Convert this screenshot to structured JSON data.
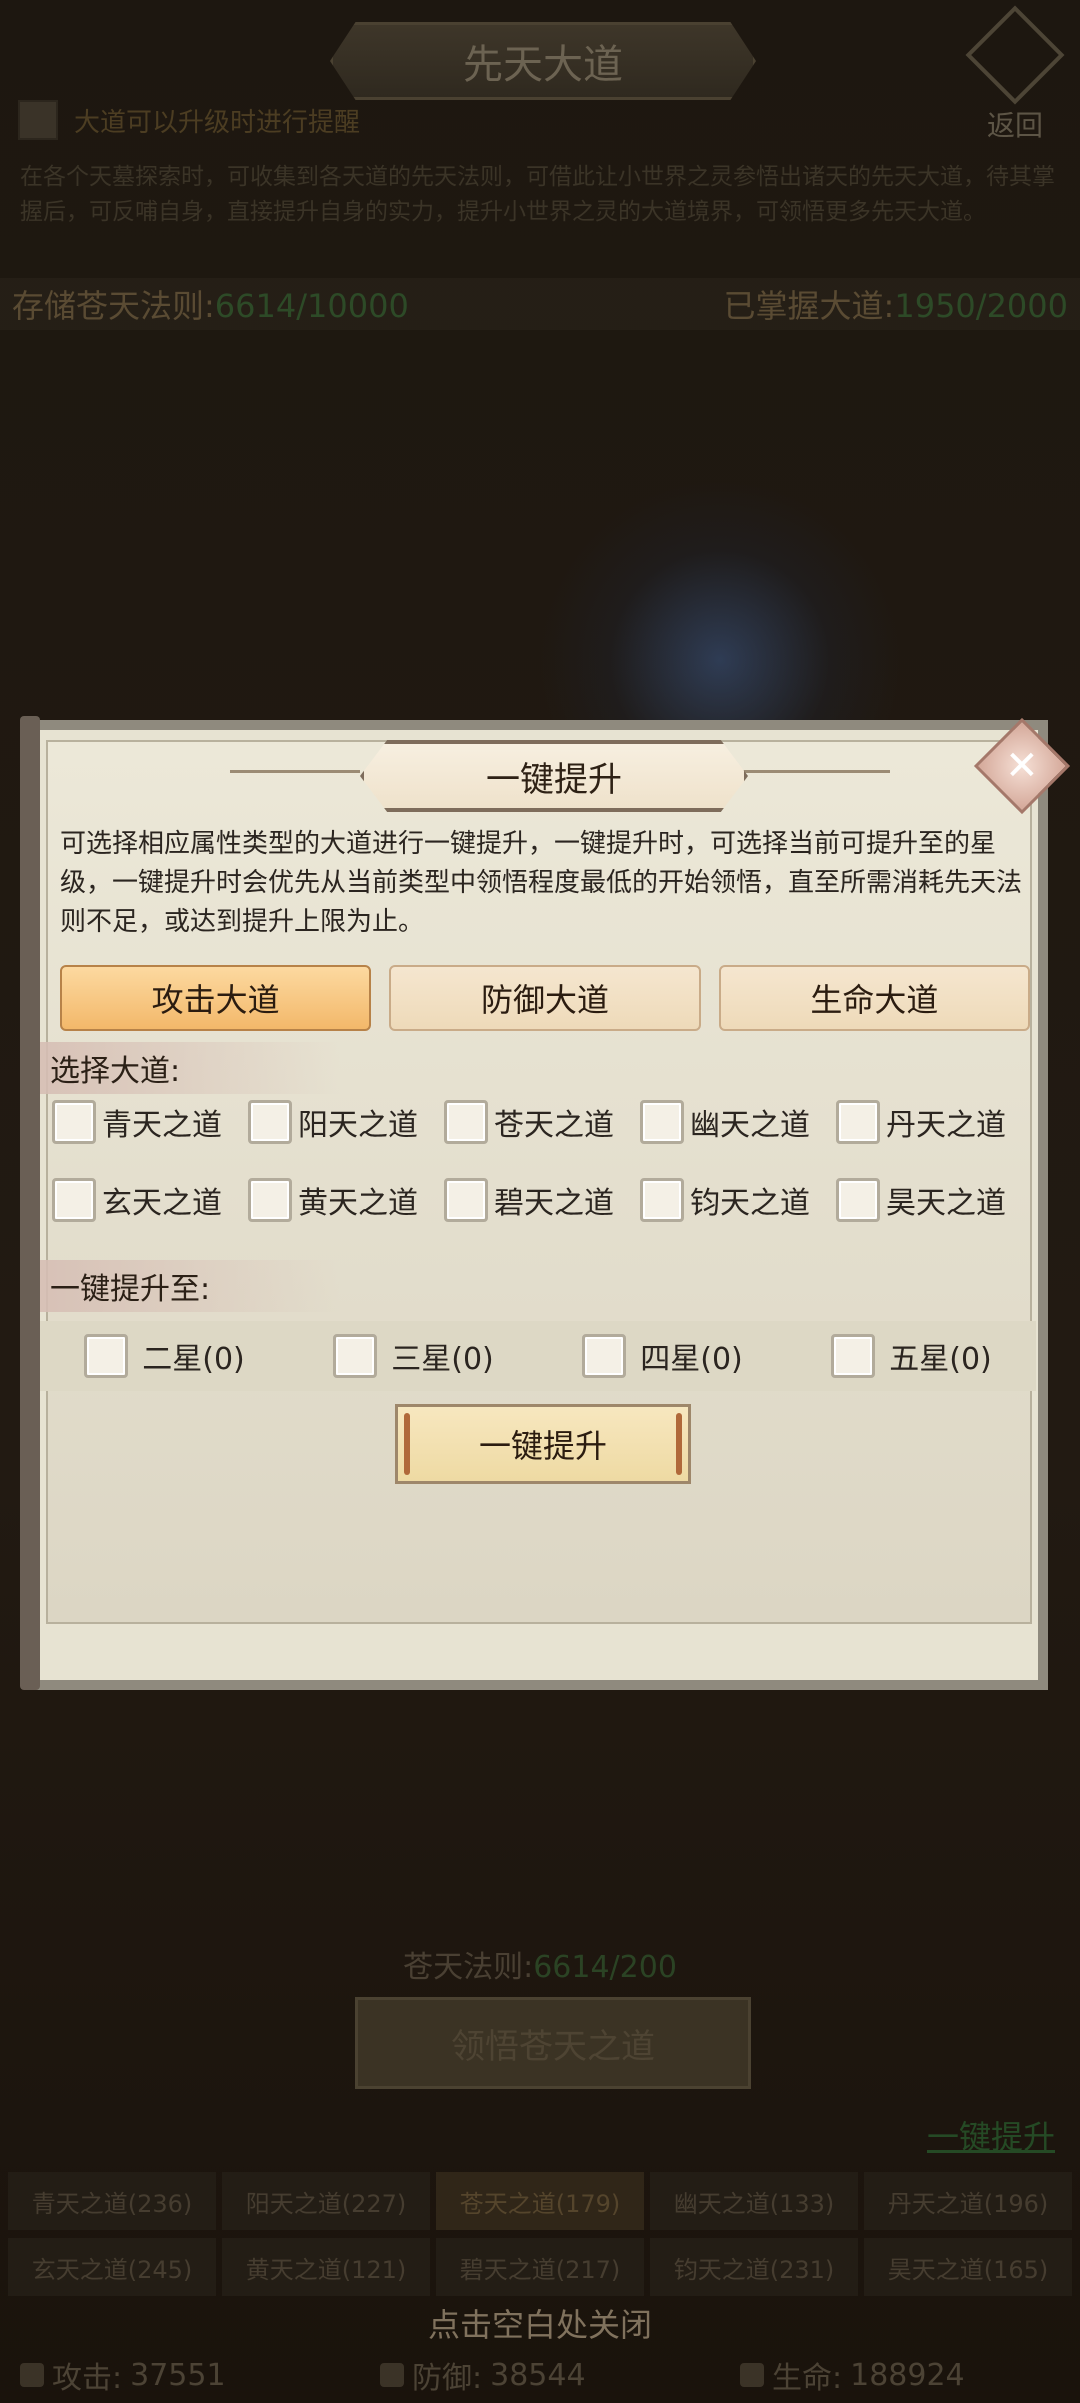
{
  "header": {
    "title": "先天大道",
    "back_label": "返回",
    "remind_text": "大道可以升级时进行提醒",
    "description": "在各个天墓探索时，可收集到各天道的先天法则，可借此让小世界之灵参悟出诸天的先天大道，待其掌握后，可反哺自身，直接提升自身的实力，提升小世界之灵的大道境界，可领悟更多先天大道。",
    "stored_label": "存储苍天法则:",
    "stored_value": "6614/10000",
    "mastered_label": "已掌握大道:",
    "mastered_value": "1950/2000"
  },
  "dialog": {
    "title": "一键提升",
    "close_icon": "x-icon",
    "description": "可选择相应属性类型的大道进行一键提升，一键提升时，可选择当前可提升至的星级，一键提升时会优先从当前类型中领悟程度最低的开始领悟，直至所需消耗先天法则不足，或达到提升上限为止。",
    "tabs": [
      {
        "label": "攻击大道",
        "active": true
      },
      {
        "label": "防御大道",
        "active": false
      },
      {
        "label": "生命大道",
        "active": false
      }
    ],
    "select_dao_label": "选择大道:",
    "daos": [
      {
        "label": "青天之道"
      },
      {
        "label": "阳天之道"
      },
      {
        "label": "苍天之道"
      },
      {
        "label": "幽天之道"
      },
      {
        "label": "丹天之道"
      },
      {
        "label": "玄天之道"
      },
      {
        "label": "黄天之道"
      },
      {
        "label": "碧天之道"
      },
      {
        "label": "钧天之道"
      },
      {
        "label": "昊天之道"
      }
    ],
    "upgrade_to_label": "一键提升至:",
    "stars": [
      {
        "label": "二星(0)"
      },
      {
        "label": "三星(0)"
      },
      {
        "label": "四星(0)"
      },
      {
        "label": "五星(0)"
      }
    ],
    "confirm_label": "一键提升"
  },
  "bottom": {
    "law_label": "苍天法则:",
    "law_value": "6614/200",
    "comprehend_label": "领悟苍天之道",
    "upgrade_link": "一键提升",
    "dao_list": [
      {
        "label": "青天之道(236)"
      },
      {
        "label": "阳天之道(227)"
      },
      {
        "label": "苍天之道(179)"
      },
      {
        "label": "幽天之道(133)"
      },
      {
        "label": "丹天之道(196)"
      },
      {
        "label": "玄天之道(245)"
      },
      {
        "label": "黄天之道(121)"
      },
      {
        "label": "碧天之道(217)"
      },
      {
        "label": "钧天之道(231)"
      },
      {
        "label": "昊天之道(165)"
      }
    ],
    "close_hint": "点击空白处关闭",
    "attack_label": "攻击:",
    "attack_value": "37551",
    "defense_label": "防御:",
    "defense_value": "38544",
    "life_label": "生命:",
    "life_value": "188924"
  }
}
